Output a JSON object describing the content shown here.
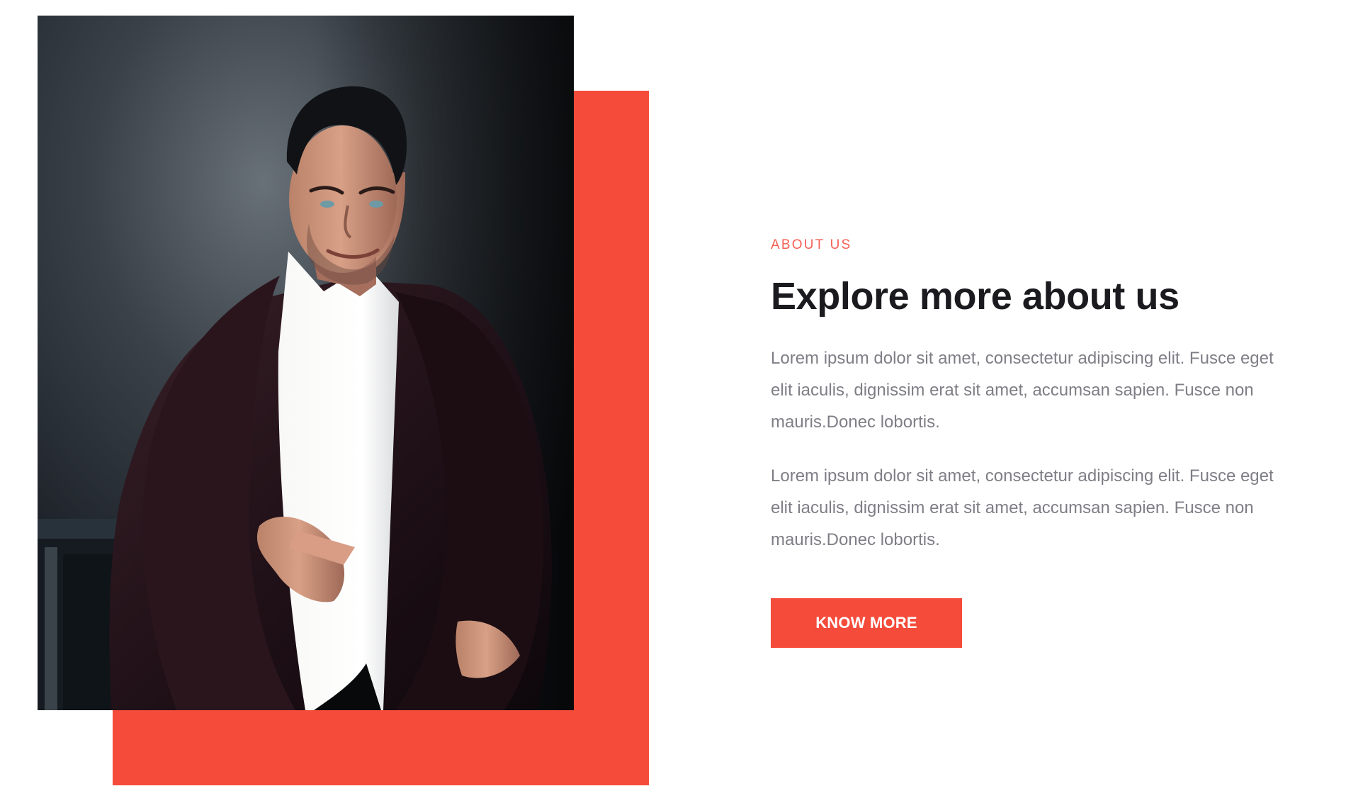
{
  "about_section": {
    "eyebrow": "ABOUT US",
    "heading": "Explore more about us",
    "paragraphs": [
      "Lorem ipsum dolor sit amet, consectetur adipiscing elit. Fusce eget elit iaculis, dignissim erat sit amet, accumsan sapien. Fusce non mauris.Donec lobortis.",
      "Lorem ipsum dolor sit amet, consectetur adipiscing elit. Fusce eget elit iaculis, dignissim erat sit amet, accumsan sapien. Fusce non mauris.Donec lobortis."
    ],
    "button_label": "KNOW MORE"
  },
  "colors": {
    "accent": "#f54b3b",
    "heading": "#1b1b1f",
    "body": "#7e7e86",
    "background": "#ffffff"
  },
  "visual": {
    "photo_subject": "man-in-dark-blazer-and-white-shirt"
  }
}
